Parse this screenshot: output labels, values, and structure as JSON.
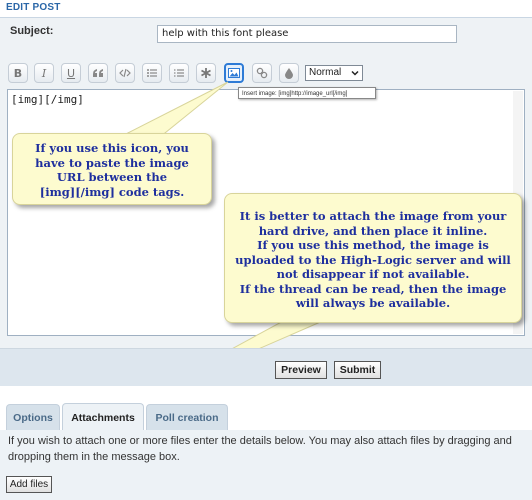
{
  "header": {
    "title": "EDIT POST"
  },
  "subject": {
    "label": "Subject:",
    "value": "help with this font please"
  },
  "toolbar": {
    "buttons": [
      {
        "label": "B",
        "icon": "bold-icon"
      },
      {
        "label": "I",
        "icon": "italic-icon"
      },
      {
        "label": "U",
        "icon": "underline-icon"
      },
      {
        "label": "",
        "icon": "quote-icon"
      },
      {
        "label": "",
        "icon": "code-icon"
      },
      {
        "label": "",
        "icon": "list-icon"
      },
      {
        "label": "",
        "icon": "numbered-list-icon"
      },
      {
        "label": "",
        "icon": "asterisk-icon"
      },
      {
        "label": "",
        "icon": "image-icon",
        "active": true
      },
      {
        "label": "",
        "icon": "link-icon"
      },
      {
        "label": "",
        "icon": "color-icon"
      }
    ],
    "font_size": "Normal",
    "tooltip": "Insert image: [img]http://image_url[/img]"
  },
  "editor": {
    "content": "[img][/img]"
  },
  "callout1": {
    "lines": [
      "If you use this icon, you",
      "have to paste the image",
      "URL between the",
      "[img][/img] code tags."
    ]
  },
  "callout2": {
    "lines": [
      "It is better to attach the image from your",
      "hard drive, and then place it inline.",
      "If you use this method, the image is",
      "uploaded to the High-Logic server and will",
      "not disappear if not available.",
      "If the thread can be read, then the image",
      "will always be available."
    ]
  },
  "actions": {
    "preview": "Preview",
    "submit": "Submit"
  },
  "tabs": [
    {
      "label": "Options"
    },
    {
      "label": "Attachments",
      "active": true
    },
    {
      "label": "Poll creation"
    }
  ],
  "attachments": {
    "info": "If you wish to attach one or more files enter the details below. You may also attach files by dragging and dropping them in the message box.",
    "add_files": "Add files"
  },
  "colors": {
    "accent": "#2b67a8",
    "callout_bg": "#fdfbcf",
    "callout_text": "#1e2f9e"
  }
}
